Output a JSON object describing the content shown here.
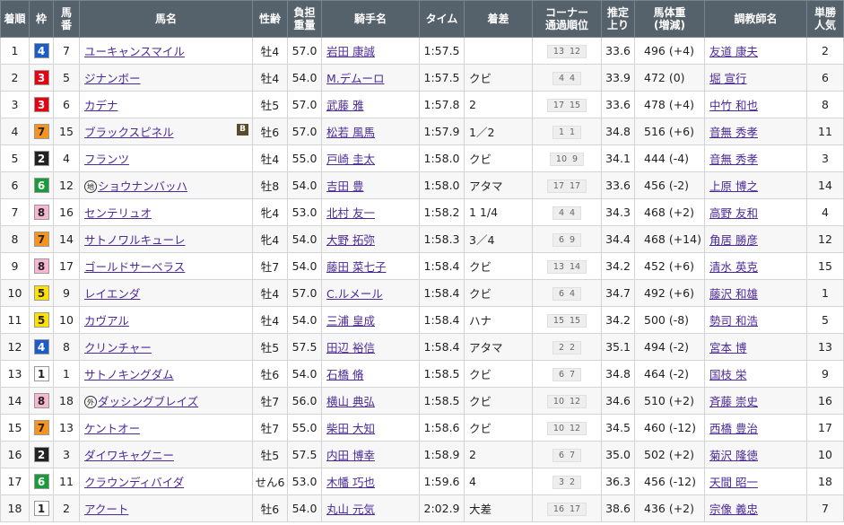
{
  "headers": {
    "rank": "着順",
    "waku": "枠",
    "umaban1": "馬",
    "umaban2": "番",
    "name": "馬名",
    "sexage": "性齢",
    "weight1": "負担",
    "weight2": "重量",
    "jockey": "騎手名",
    "time": "タイム",
    "margin": "着差",
    "corner1": "コーナー",
    "corner2": "通過順位",
    "last1": "推定",
    "last2": "上り",
    "body1": "馬体重",
    "body2": "(増減)",
    "trainer": "調教師名",
    "pop1": "単勝",
    "pop2": "人気"
  },
  "mark_labels": {
    "chi": "地",
    "gai": "外",
    "blinker": "B"
  },
  "waku_colors": {
    "1": {
      "bg": "#ffffff",
      "fg": "#222222"
    },
    "2": {
      "bg": "#222222",
      "fg": "#ffffff"
    },
    "3": {
      "bg": "#e60012",
      "fg": "#ffffff"
    },
    "4": {
      "bg": "#1c5cc9",
      "fg": "#ffffff"
    },
    "5": {
      "bg": "#ffe100",
      "fg": "#222222"
    },
    "6": {
      "bg": "#1a9b3b",
      "fg": "#ffffff"
    },
    "7": {
      "bg": "#f7941d",
      "fg": "#222222"
    },
    "8": {
      "bg": "#f7b6d2",
      "fg": "#222222"
    }
  },
  "rows": [
    {
      "rank": "1",
      "waku": "4",
      "umaban": "7",
      "name": "ユーキャンスマイル",
      "mark": "",
      "blinker": false,
      "sexage": "牡4",
      "weight": "57.0",
      "jockey": "岩田 康誠",
      "time": "1:57.5",
      "margin": "",
      "corner": [
        "13",
        "12"
      ],
      "last": "33.6",
      "body": "496 (+4)",
      "trainer": "友道 康夫",
      "pop": "2"
    },
    {
      "rank": "2",
      "waku": "3",
      "umaban": "5",
      "name": "ジナンボー",
      "mark": "",
      "blinker": false,
      "sexage": "牡4",
      "weight": "54.0",
      "jockey": "M.デムーロ",
      "time": "1:57.5",
      "margin": "クビ",
      "corner": [
        "4",
        "4"
      ],
      "last": "33.9",
      "body": "472 (0)",
      "trainer": "堀 宣行",
      "pop": "6"
    },
    {
      "rank": "3",
      "waku": "3",
      "umaban": "6",
      "name": "カデナ",
      "mark": "",
      "blinker": false,
      "sexage": "牡5",
      "weight": "57.0",
      "jockey": "武藤 雅",
      "time": "1:57.8",
      "margin": "2",
      "corner": [
        "17",
        "15"
      ],
      "last": "33.6",
      "body": "478 (+4)",
      "trainer": "中竹 和也",
      "pop": "8"
    },
    {
      "rank": "4",
      "waku": "7",
      "umaban": "15",
      "name": "ブラックスピネル",
      "mark": "",
      "blinker": true,
      "sexage": "牡6",
      "weight": "57.0",
      "jockey": "松若 風馬",
      "time": "1:57.9",
      "margin": "1／2",
      "corner": [
        "1",
        "1"
      ],
      "last": "34.8",
      "body": "516 (+6)",
      "trainer": "音無 秀孝",
      "pop": "11"
    },
    {
      "rank": "5",
      "waku": "2",
      "umaban": "4",
      "name": "フランツ",
      "mark": "",
      "blinker": false,
      "sexage": "牡4",
      "weight": "55.0",
      "jockey": "戸崎 圭太",
      "time": "1:58.0",
      "margin": "クビ",
      "corner": [
        "10",
        "9"
      ],
      "last": "34.1",
      "body": "444 (-4)",
      "trainer": "音無 秀孝",
      "pop": "3"
    },
    {
      "rank": "6",
      "waku": "6",
      "umaban": "12",
      "name": "ショウナンバッハ",
      "mark": "chi",
      "blinker": false,
      "sexage": "牡8",
      "weight": "54.0",
      "jockey": "吉田 豊",
      "time": "1:58.0",
      "margin": "アタマ",
      "corner": [
        "17",
        "17"
      ],
      "last": "33.6",
      "body": "456 (-2)",
      "trainer": "上原 博之",
      "pop": "14"
    },
    {
      "rank": "7",
      "waku": "8",
      "umaban": "16",
      "name": "センテリュオ",
      "mark": "",
      "blinker": false,
      "sexage": "牝4",
      "weight": "53.0",
      "jockey": "北村 友一",
      "time": "1:58.2",
      "margin": "1 1/4",
      "corner": [
        "4",
        "4"
      ],
      "last": "34.3",
      "body": "468 (+2)",
      "trainer": "高野 友和",
      "pop": "4"
    },
    {
      "rank": "8",
      "waku": "7",
      "umaban": "14",
      "name": "サトノワルキューレ",
      "mark": "",
      "blinker": false,
      "sexage": "牝4",
      "weight": "54.0",
      "jockey": "大野 拓弥",
      "time": "1:58.3",
      "margin": "3／4",
      "corner": [
        "6",
        "9"
      ],
      "last": "34.4",
      "body": "468 (+14)",
      "trainer": "角居 勝彦",
      "pop": "12"
    },
    {
      "rank": "9",
      "waku": "8",
      "umaban": "17",
      "name": "ゴールドサーベラス",
      "mark": "",
      "blinker": false,
      "sexage": "牡7",
      "weight": "54.0",
      "jockey": "藤田 菜七子",
      "time": "1:58.4",
      "margin": "クビ",
      "corner": [
        "13",
        "14"
      ],
      "last": "34.2",
      "body": "452 (+6)",
      "trainer": "清水 英克",
      "pop": "15"
    },
    {
      "rank": "10",
      "waku": "5",
      "umaban": "9",
      "name": "レイエンダ",
      "mark": "",
      "blinker": false,
      "sexage": "牡4",
      "weight": "57.0",
      "jockey": "C.ルメール",
      "time": "1:58.4",
      "margin": "クビ",
      "corner": [
        "6",
        "4"
      ],
      "last": "34.7",
      "body": "492 (+6)",
      "trainer": "藤沢 和雄",
      "pop": "1"
    },
    {
      "rank": "11",
      "waku": "5",
      "umaban": "10",
      "name": "カヴアル",
      "mark": "",
      "blinker": false,
      "sexage": "牡4",
      "weight": "54.0",
      "jockey": "三浦 皇成",
      "time": "1:58.4",
      "margin": "ハナ",
      "corner": [
        "15",
        "15"
      ],
      "last": "34.2",
      "body": "500 (-8)",
      "trainer": "勢司 和浩",
      "pop": "5"
    },
    {
      "rank": "12",
      "waku": "4",
      "umaban": "8",
      "name": "クリンチャー",
      "mark": "",
      "blinker": false,
      "sexage": "牡5",
      "weight": "57.5",
      "jockey": "田辺 裕信",
      "time": "1:58.4",
      "margin": "アタマ",
      "corner": [
        "2",
        "2"
      ],
      "last": "35.1",
      "body": "494 (-2)",
      "trainer": "宮本 博",
      "pop": "13"
    },
    {
      "rank": "13",
      "waku": "1",
      "umaban": "1",
      "name": "サトノキングダム",
      "mark": "",
      "blinker": false,
      "sexage": "牡6",
      "weight": "54.0",
      "jockey": "石橋 脩",
      "time": "1:58.5",
      "margin": "クビ",
      "corner": [
        "6",
        "7"
      ],
      "last": "34.8",
      "body": "464 (-2)",
      "trainer": "国枝 栄",
      "pop": "9"
    },
    {
      "rank": "14",
      "waku": "8",
      "umaban": "18",
      "name": "ダッシングブレイズ",
      "mark": "gai",
      "blinker": false,
      "sexage": "牡7",
      "weight": "56.0",
      "jockey": "横山 典弘",
      "time": "1:58.5",
      "margin": "クビ",
      "corner": [
        "10",
        "12"
      ],
      "last": "34.6",
      "body": "510 (+2)",
      "trainer": "斉藤 崇史",
      "pop": "16"
    },
    {
      "rank": "15",
      "waku": "7",
      "umaban": "13",
      "name": "ケントオー",
      "mark": "",
      "blinker": false,
      "sexage": "牡7",
      "weight": "55.0",
      "jockey": "柴田 大知",
      "time": "1:58.6",
      "margin": "クビ",
      "corner": [
        "10",
        "12"
      ],
      "last": "34.5",
      "body": "460 (-12)",
      "trainer": "西橋 豊治",
      "pop": "17"
    },
    {
      "rank": "16",
      "waku": "2",
      "umaban": "3",
      "name": "ダイワキャグニー",
      "mark": "",
      "blinker": false,
      "sexage": "牡5",
      "weight": "57.5",
      "jockey": "内田 博幸",
      "time": "1:58.9",
      "margin": "2",
      "corner": [
        "6",
        "7"
      ],
      "last": "35.0",
      "body": "502 (+2)",
      "trainer": "菊沢 隆徳",
      "pop": "10"
    },
    {
      "rank": "17",
      "waku": "6",
      "umaban": "11",
      "name": "クラウンディバイダ",
      "mark": "",
      "blinker": false,
      "sexage": "せん6",
      "weight": "53.0",
      "jockey": "木幡 巧也",
      "time": "1:59.6",
      "margin": "4",
      "corner": [
        "3",
        "2"
      ],
      "last": "36.3",
      "body": "456 (-12)",
      "trainer": "天間 昭一",
      "pop": "18"
    },
    {
      "rank": "18",
      "waku": "1",
      "umaban": "2",
      "name": "アクート",
      "mark": "",
      "blinker": false,
      "sexage": "牡6",
      "weight": "54.0",
      "jockey": "丸山 元気",
      "time": "2:02.9",
      "margin": "大差",
      "corner": [
        "16",
        "17"
      ],
      "last": "38.6",
      "body": "436 (+2)",
      "trainer": "宗像 義忠",
      "pop": "7"
    }
  ]
}
